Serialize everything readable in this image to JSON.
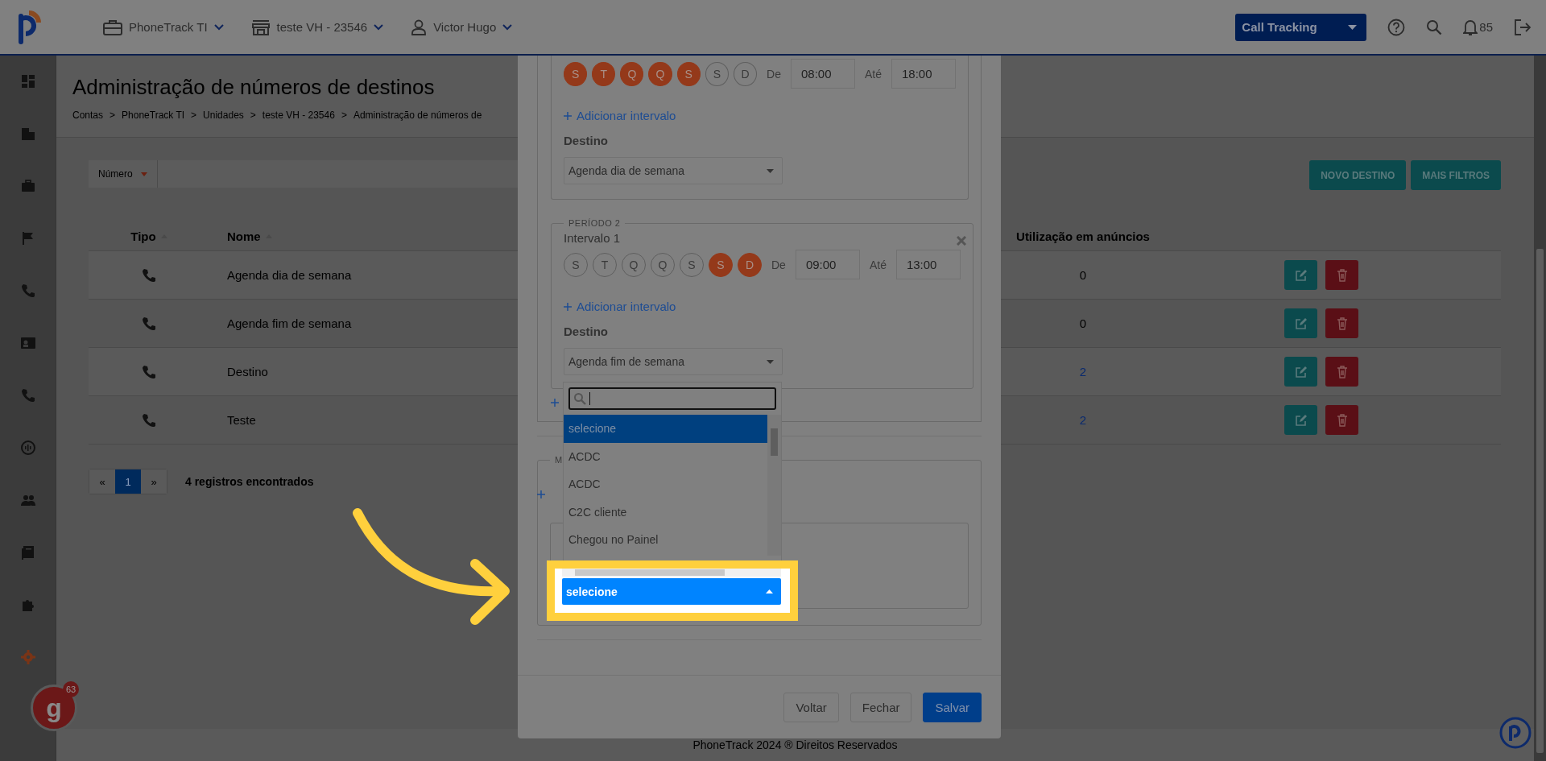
{
  "header": {
    "account": "PhoneTrack TI",
    "unit": "teste VH - 23546",
    "user": "Victor Hugo",
    "product": "Call Tracking",
    "notifications": "85"
  },
  "sidebar": {
    "items": [
      {
        "kind": "dashboard",
        "selected": false
      },
      {
        "kind": "building",
        "selected": false
      },
      {
        "kind": "briefcase",
        "selected": false
      },
      {
        "kind": "flag",
        "selected": false
      },
      {
        "kind": "phone",
        "selected": false
      },
      {
        "kind": "contact",
        "selected": false
      },
      {
        "kind": "phone",
        "selected": false
      },
      {
        "kind": "audio",
        "selected": false
      },
      {
        "kind": "people",
        "selected": false
      },
      {
        "kind": "book",
        "selected": false
      },
      {
        "kind": "puzzle",
        "selected": false
      },
      {
        "kind": "gear",
        "selected": true
      }
    ]
  },
  "page": {
    "title": "Administração de números de destinos",
    "separator": ">",
    "breadcrumb": [
      "Contas",
      "PhoneTrack TI",
      "Unidades",
      "teste VH - 23546",
      "Administração de números de"
    ]
  },
  "filter": {
    "field": "Número"
  },
  "actions": [
    {
      "label": "NOVO DESTINO"
    },
    {
      "label": "MAIS FILTROS"
    }
  ],
  "table": {
    "columns": [
      {
        "label": "Tipo",
        "sortable": true
      },
      {
        "label": "Nome",
        "sortable": true
      },
      {
        "label": "Utilização em anúncios",
        "sortable": false
      }
    ],
    "rows": [
      {
        "name": "Agenda dia de semana",
        "usage": "0",
        "linked": false
      },
      {
        "name": "Agenda fim de semana",
        "usage": "0",
        "linked": false
      },
      {
        "name": "Destino",
        "usage": "2",
        "linked": true
      },
      {
        "name": "Teste",
        "usage": "2",
        "linked": true
      }
    ]
  },
  "pagination": {
    "prev": "«",
    "next": "»",
    "pages": [
      {
        "label": "1",
        "selected": true
      }
    ],
    "summary": "4 registros encontrados"
  },
  "modal": {
    "periods": [
      {
        "days": [
          {
            "label": "S",
            "selected": true
          },
          {
            "label": "T",
            "selected": true
          },
          {
            "label": "Q",
            "selected": true
          },
          {
            "label": "Q",
            "selected": true
          },
          {
            "label": "S",
            "selected": true
          },
          {
            "label": "S",
            "selected": false
          },
          {
            "label": "D",
            "selected": false
          }
        ],
        "from_label": "De",
        "from": "08:00",
        "to_label": "Até",
        "to": "18:00",
        "add_interval": "Adicionar intervalo",
        "destination_label": "Destino",
        "destination": "Agenda dia de semana"
      },
      {
        "legend": "PERÍODO 2",
        "closable": true,
        "interval_label": "Intervalo 1",
        "days": [
          {
            "label": "S",
            "selected": false
          },
          {
            "label": "T",
            "selected": false
          },
          {
            "label": "Q",
            "selected": false
          },
          {
            "label": "Q",
            "selected": false
          },
          {
            "label": "S",
            "selected": false
          },
          {
            "label": "S",
            "selected": true
          },
          {
            "label": "D",
            "selected": true
          }
        ],
        "from_label": "De",
        "from": "09:00",
        "to_label": "Até",
        "to": "13:00",
        "add_interval": "Adicionar intervalo",
        "destination_label": "Destino",
        "destination": "Agenda fim de semana"
      }
    ],
    "dropdown": {
      "options": [
        {
          "label": "selecione",
          "selected": true
        },
        {
          "label": "ACDC",
          "selected": false
        },
        {
          "label": "ACDC",
          "selected": false
        },
        {
          "label": "C2C cliente",
          "selected": false
        },
        {
          "label": "Chegou no Painel",
          "selected": false
        }
      ]
    },
    "section_legend": "M",
    "highlighted_select": "selecione",
    "buttons": [
      {
        "label": "Voltar",
        "kind": "secondary"
      },
      {
        "label": "Fechar",
        "kind": "secondary"
      },
      {
        "label": "Salvar",
        "kind": "primary"
      }
    ]
  },
  "footer": "PhoneTrack 2024 ® Direitos Reservados",
  "assistant": {
    "letter": "g",
    "count": "63"
  }
}
